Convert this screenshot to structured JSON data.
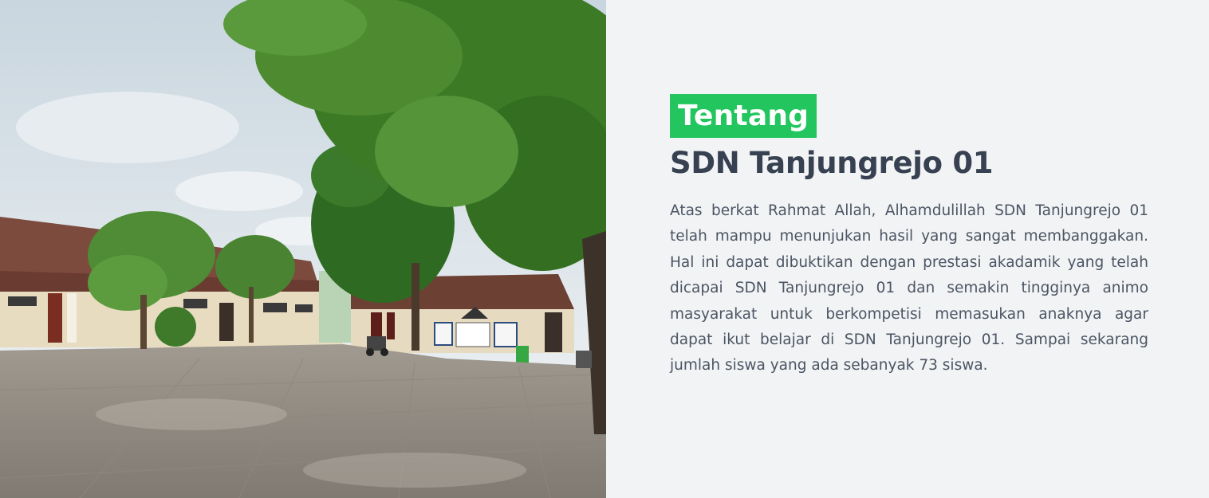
{
  "about": {
    "badge": "Tentang",
    "title": "SDN Tanjungrejo 01",
    "description": "Atas berkat Rahmat Allah, Alhamdulillah SDN Tanjungrejo 01 telah mampu menunjukan hasil yang sangat membanggakan. Hal ini dapat dibuktikan dengan prestasi akadamik yang telah dicapai SDN Tanjungrejo 01 dan semakin tingginya animo masyarakat untuk berkompetisi memasukan anaknya agar dapat ikut belajar di SDN Tanjungrejo 01. Sampai sekarang jumlah siswa yang ada sebanyak 73 siswa."
  },
  "photo": {
    "subject": "school-courtyard-photo"
  },
  "colors": {
    "badge_bg": "#22c55e",
    "title": "#374151",
    "text": "#4b5563",
    "background": "#f2f3f5"
  }
}
